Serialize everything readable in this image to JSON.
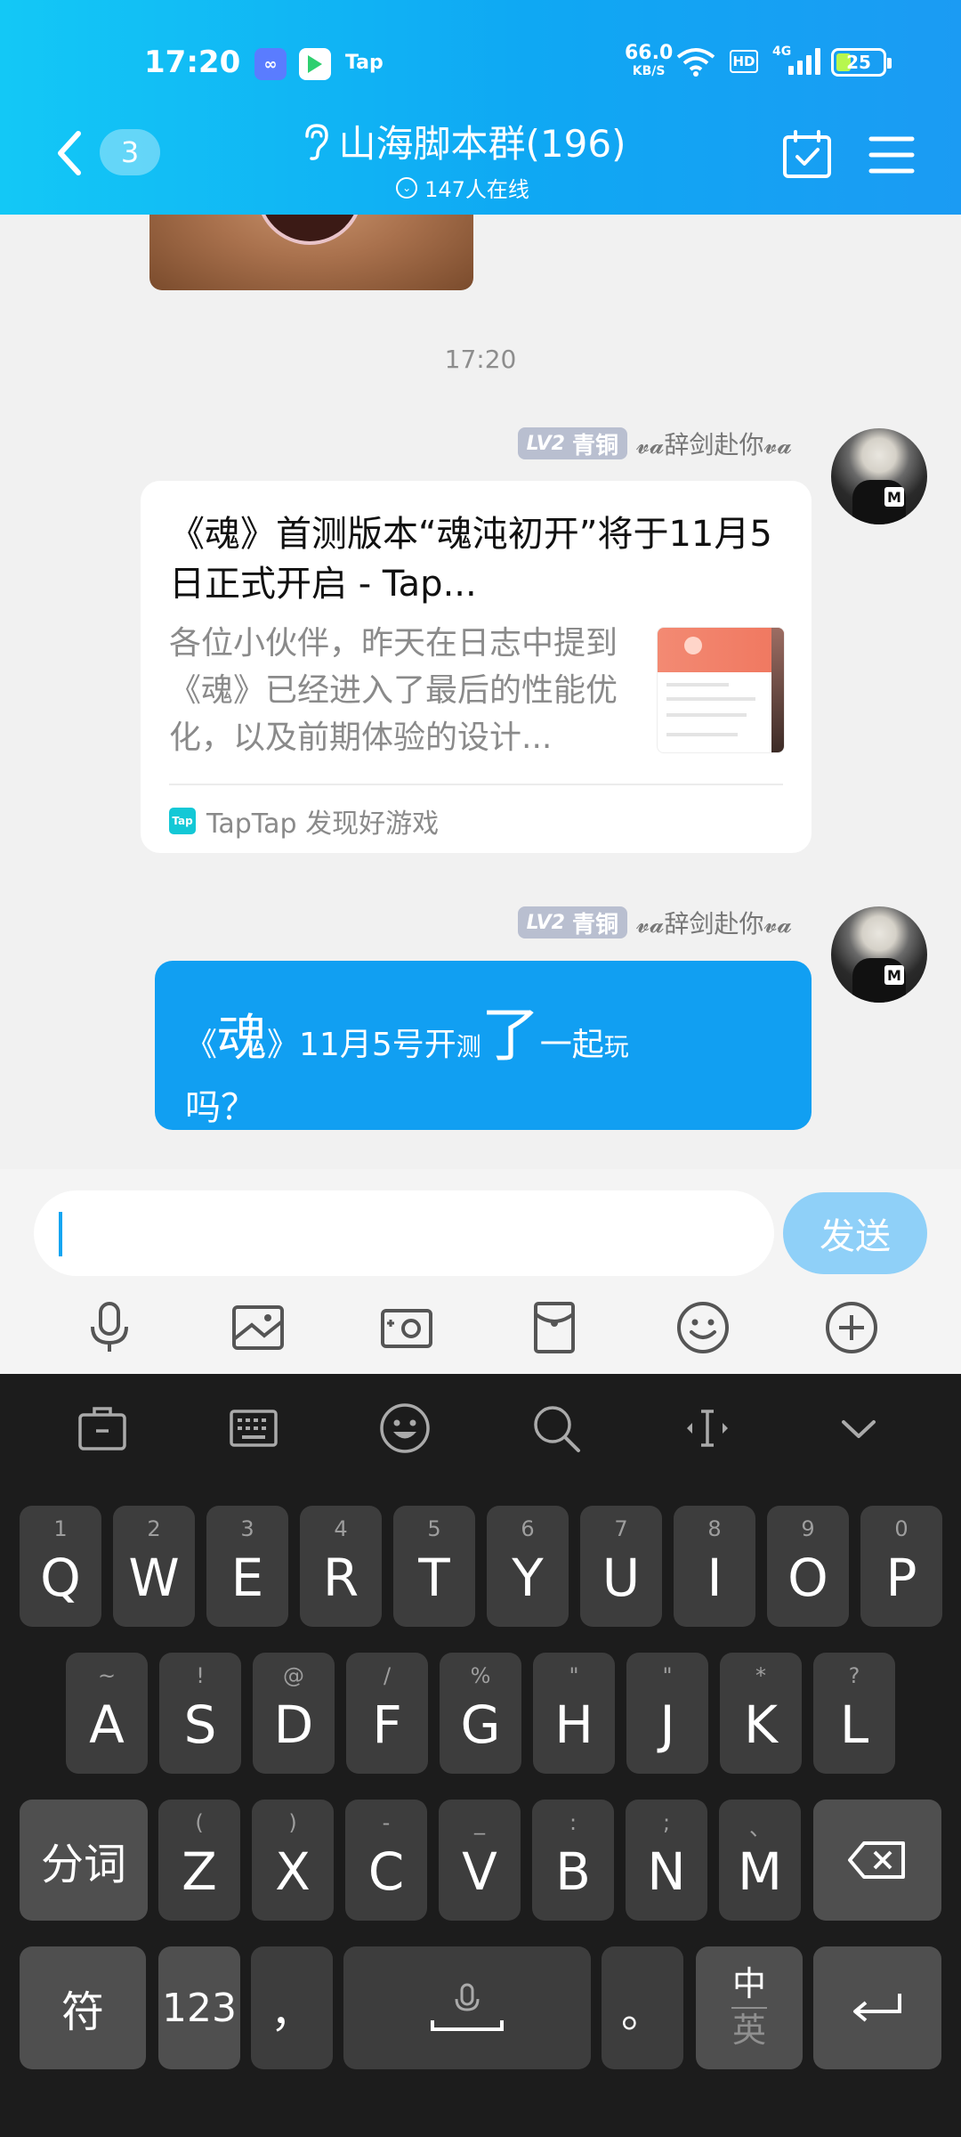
{
  "status_bar": {
    "time": "17:20",
    "app_icon_a": "infinity-app-icon",
    "app_icon_b": "play-app-icon",
    "tap_label": "Tap",
    "net_speed": "66.0",
    "net_speed_unit": "KB/S",
    "hd_label": "HD",
    "signal_label": "4G",
    "battery": "25",
    "battery_color": "#b7f74e"
  },
  "header": {
    "unread_count": "3",
    "title": "山海脚本群(196)",
    "online": "147人在线",
    "accent": "#13c8f6"
  },
  "chat": {
    "timestamp": "17:20",
    "messages": [
      {
        "level_badge": "LV2",
        "level_name": "青铜",
        "sender": "𝓿𝓪辞剑赴你𝓿𝓪",
        "card": {
          "title": "《魂》首测版本“魂沌初开”将于11月5日正式开启 - Tap...",
          "description": "各位小伙伴，昨天在日志中提到《魂》已经进入了最后的性能优化，以及前期体验的设计...",
          "source": "TapTap 发现好游戏",
          "source_icon_label": "Tap"
        }
      },
      {
        "level_badge": "LV2",
        "level_name": "青铜",
        "sender": "𝓿𝓪辞剑赴你𝓿𝓪",
        "text_parts": [
          "《",
          "魂",
          "》11月5号开",
          "测",
          "了",
          "一起",
          "玩"
        ],
        "text_line2": "吗？",
        "bubble_color": "#119ff2"
      }
    ]
  },
  "input": {
    "value": "",
    "send_label": "发送",
    "send_color": "#8fd0f8"
  },
  "toolbar_icons": [
    "microphone-icon",
    "image-icon",
    "camera-icon",
    "red-packet-icon",
    "emoji-icon",
    "plus-icon"
  ],
  "keyboard": {
    "tool_icons": [
      "clipboard-icon",
      "keyboard-icon",
      "emoji-icon",
      "search-icon",
      "text-cursor-icon",
      "collapse-icon"
    ],
    "row1": [
      {
        "k": "Q",
        "s": "1"
      },
      {
        "k": "W",
        "s": "2"
      },
      {
        "k": "E",
        "s": "3"
      },
      {
        "k": "R",
        "s": "4"
      },
      {
        "k": "T",
        "s": "5"
      },
      {
        "k": "Y",
        "s": "6"
      },
      {
        "k": "U",
        "s": "7"
      },
      {
        "k": "I",
        "s": "8"
      },
      {
        "k": "O",
        "s": "9"
      },
      {
        "k": "P",
        "s": "0"
      }
    ],
    "row2": [
      {
        "k": "A",
        "s": "~"
      },
      {
        "k": "S",
        "s": "!"
      },
      {
        "k": "D",
        "s": "@"
      },
      {
        "k": "F",
        "s": "/"
      },
      {
        "k": "G",
        "s": "%"
      },
      {
        "k": "H",
        "s": "\""
      },
      {
        "k": "J",
        "s": "\""
      },
      {
        "k": "K",
        "s": "*"
      },
      {
        "k": "L",
        "s": "?"
      }
    ],
    "row3": [
      {
        "k": "Z",
        "s": "("
      },
      {
        "k": "X",
        "s": ")"
      },
      {
        "k": "C",
        "s": "-"
      },
      {
        "k": "V",
        "s": "_"
      },
      {
        "k": "B",
        "s": ":"
      },
      {
        "k": "N",
        "s": ";"
      },
      {
        "k": "M",
        "s": "、"
      }
    ],
    "segment_label": "分词",
    "symbol_label": "符",
    "numeric_label": "123",
    "comma_label": "，",
    "period_label": "。",
    "lang_top": "中",
    "lang_bottom": "英"
  }
}
